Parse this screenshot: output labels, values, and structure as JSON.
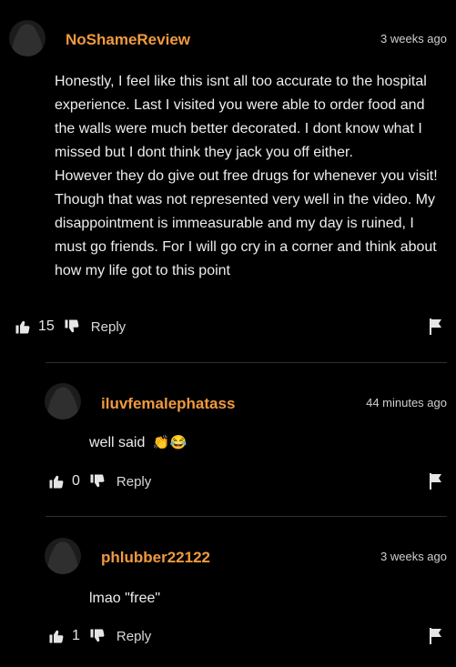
{
  "comments": [
    {
      "username": "NoShameReview",
      "time": "3 weeks ago",
      "text": "Honestly, I feel like this isnt all too accurate to the hospital experience. Last I visited you were able to order food and the walls were much better decorated. I dont know what I missed but I dont think they jack you off either.\nHowever they do give out free drugs for whenever you visit! Though that was not represented very well in the video. My disappointment is immeasurable and my day is ruined, I must go friends. For I will go cry in a corner and think about how my life got to this point",
      "likes": "15",
      "reply_label": "Reply"
    },
    {
      "username": "iluvfemalephatass",
      "time": "44 minutes ago",
      "text": "well said",
      "emojis": "👏😂",
      "likes": "0",
      "reply_label": "Reply"
    },
    {
      "username": "phlubber22122",
      "time": "3 weeks ago",
      "text": "lmao \"free\"",
      "likes": "1",
      "reply_label": "Reply"
    }
  ],
  "colors": {
    "username": "#f09a3e",
    "background": "#000000"
  },
  "icons": [
    "thumbs-up-icon",
    "thumbs-down-icon",
    "flag-icon",
    "avatar-placeholder"
  ]
}
